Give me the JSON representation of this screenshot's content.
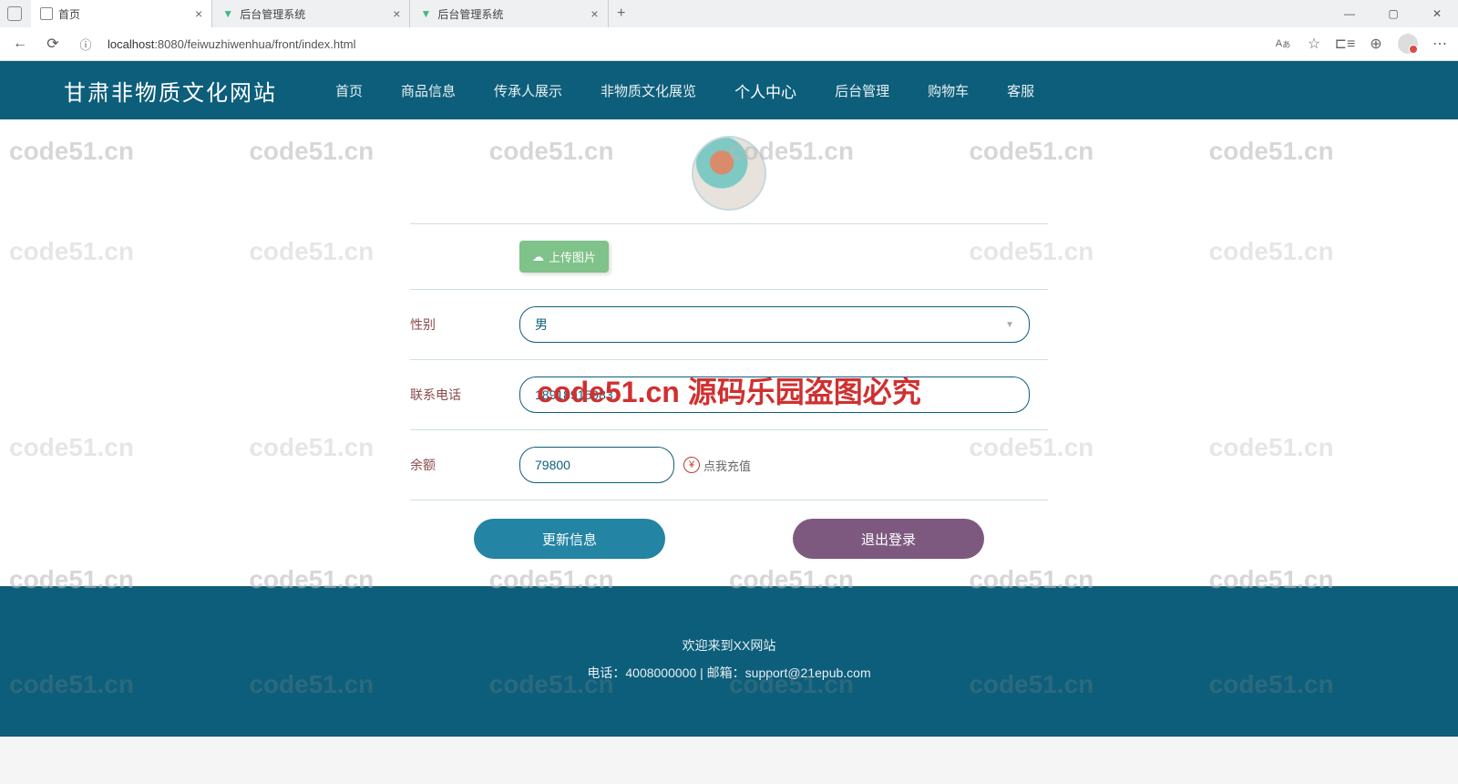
{
  "browser": {
    "tabs": [
      {
        "title": "首页",
        "type": "doc"
      },
      {
        "title": "后台管理系统",
        "type": "vue"
      },
      {
        "title": "后台管理系统",
        "type": "vue"
      }
    ],
    "url_host": "localhost",
    "url_port": ":8080",
    "url_path": "/feiwuzhiwenhua/front/index.html"
  },
  "site": {
    "title": "甘肃非物质文化网站",
    "nav": [
      "首页",
      "商品信息",
      "传承人展示",
      "非物质文化展览",
      "个人中心",
      "后台管理",
      "购物车",
      "客服"
    ],
    "active_nav_index": 4
  },
  "form": {
    "upload_label": "上传图片",
    "gender_label": "性别",
    "gender_value": "男",
    "phone_label": "联系电话",
    "phone_value": "18918915983",
    "balance_label": "余额",
    "balance_value": "79800",
    "recharge_text": "点我充值",
    "update_btn": "更新信息",
    "logout_btn": "退出登录"
  },
  "footer": {
    "welcome": "欢迎来到XX网站",
    "contact": "电话：4008000000 | 邮箱：support@21epub.com"
  },
  "watermark": {
    "text": "code51.cn",
    "center": "code51.cn 源码乐园盗图必究"
  }
}
